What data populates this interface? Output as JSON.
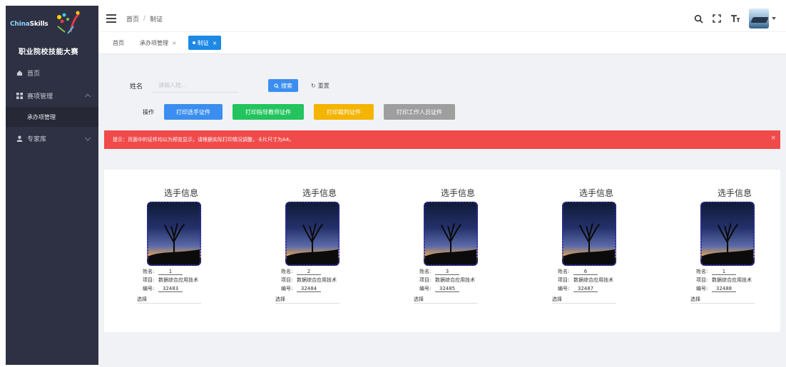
{
  "sidebar": {
    "logo_text_a": "China",
    "logo_text_b": "Skills",
    "logo_title": "职业院校技能大赛",
    "items": [
      {
        "label": "首页",
        "icon": "home-icon"
      },
      {
        "label": "赛项管理",
        "icon": "grid-icon"
      },
      {
        "label": "承办项管理",
        "icon": ""
      },
      {
        "label": "专家库",
        "icon": "user-icon"
      }
    ]
  },
  "header": {
    "breadcrumb": [
      "首页",
      "制证"
    ]
  },
  "tabs": [
    {
      "label": "首页"
    },
    {
      "label": "承办项管理"
    },
    {
      "label": "制证"
    }
  ],
  "search": {
    "name_label": "姓名",
    "name_placeholder": "请输入姓...",
    "search_label": "搜索",
    "reset_label": "重置"
  },
  "actions": {
    "label": "操作",
    "buttons": [
      "打印选手证件",
      "打印指导教师证件",
      "打印裁判证件",
      "打印工作人员证件"
    ]
  },
  "alert": {
    "text": "提示：页面中的证件均以为预览显示，请根据实际打印情况调整，卡片尺寸为A4。"
  },
  "cards": [
    {
      "title": "选手信息",
      "name_label": "姓名:",
      "name": "1",
      "project_label": "项目:",
      "project": "数据综合应用技术",
      "id_label": "编号:",
      "id": "32483",
      "choose": "选择"
    },
    {
      "title": "选手信息",
      "name_label": "姓名:",
      "name": "2",
      "project_label": "项目:",
      "project": "数据综合应用技术",
      "id_label": "编号:",
      "id": "32484",
      "choose": "选择"
    },
    {
      "title": "选手信息",
      "name_label": "姓名:",
      "name": "3",
      "project_label": "项目:",
      "project": "数据综合应用技术",
      "id_label": "编号:",
      "id": "32485",
      "choose": "选择"
    },
    {
      "title": "选手信息",
      "name_label": "姓名:",
      "name": "6",
      "project_label": "项目:",
      "project": "数据综合应用技术",
      "id_label": "编号:",
      "id": "32487",
      "choose": "选择"
    },
    {
      "title": "选手信息",
      "name_label": "姓名:",
      "name": "1",
      "project_label": "项目:",
      "project": "数据综合应用技术",
      "id_label": "编号:",
      "id": "32488",
      "choose": "选择"
    }
  ],
  "colors": {
    "sidebar_bg": "#2e3143",
    "primary": "#3b8ef0",
    "success": "#23c45e",
    "warning": "#f4b400",
    "info": "#9e9e9e",
    "danger": "#f04a4a"
  }
}
